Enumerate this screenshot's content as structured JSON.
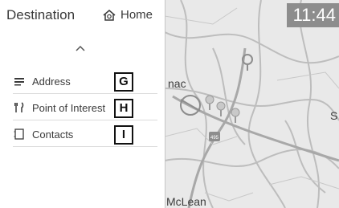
{
  "panel": {
    "title": "Destination",
    "home_label": "Home",
    "items": [
      {
        "label": "Address",
        "callout": "G",
        "icon": "address-icon"
      },
      {
        "label": "Point of Interest",
        "callout": "H",
        "icon": "restaurant-icon"
      },
      {
        "label": "Contacts",
        "callout": "I",
        "icon": "contacts-icon"
      }
    ]
  },
  "map": {
    "clock": "11:44",
    "labels": {
      "left": "nac",
      "right": "S",
      "bottom": "McLean"
    },
    "route_shields": [
      "495"
    ]
  },
  "colors": {
    "map_bg": "#e9e9e9",
    "clock_bg": "#8d8d8d",
    "road": "#c2c2c2",
    "pin": "#9a9a9a"
  }
}
